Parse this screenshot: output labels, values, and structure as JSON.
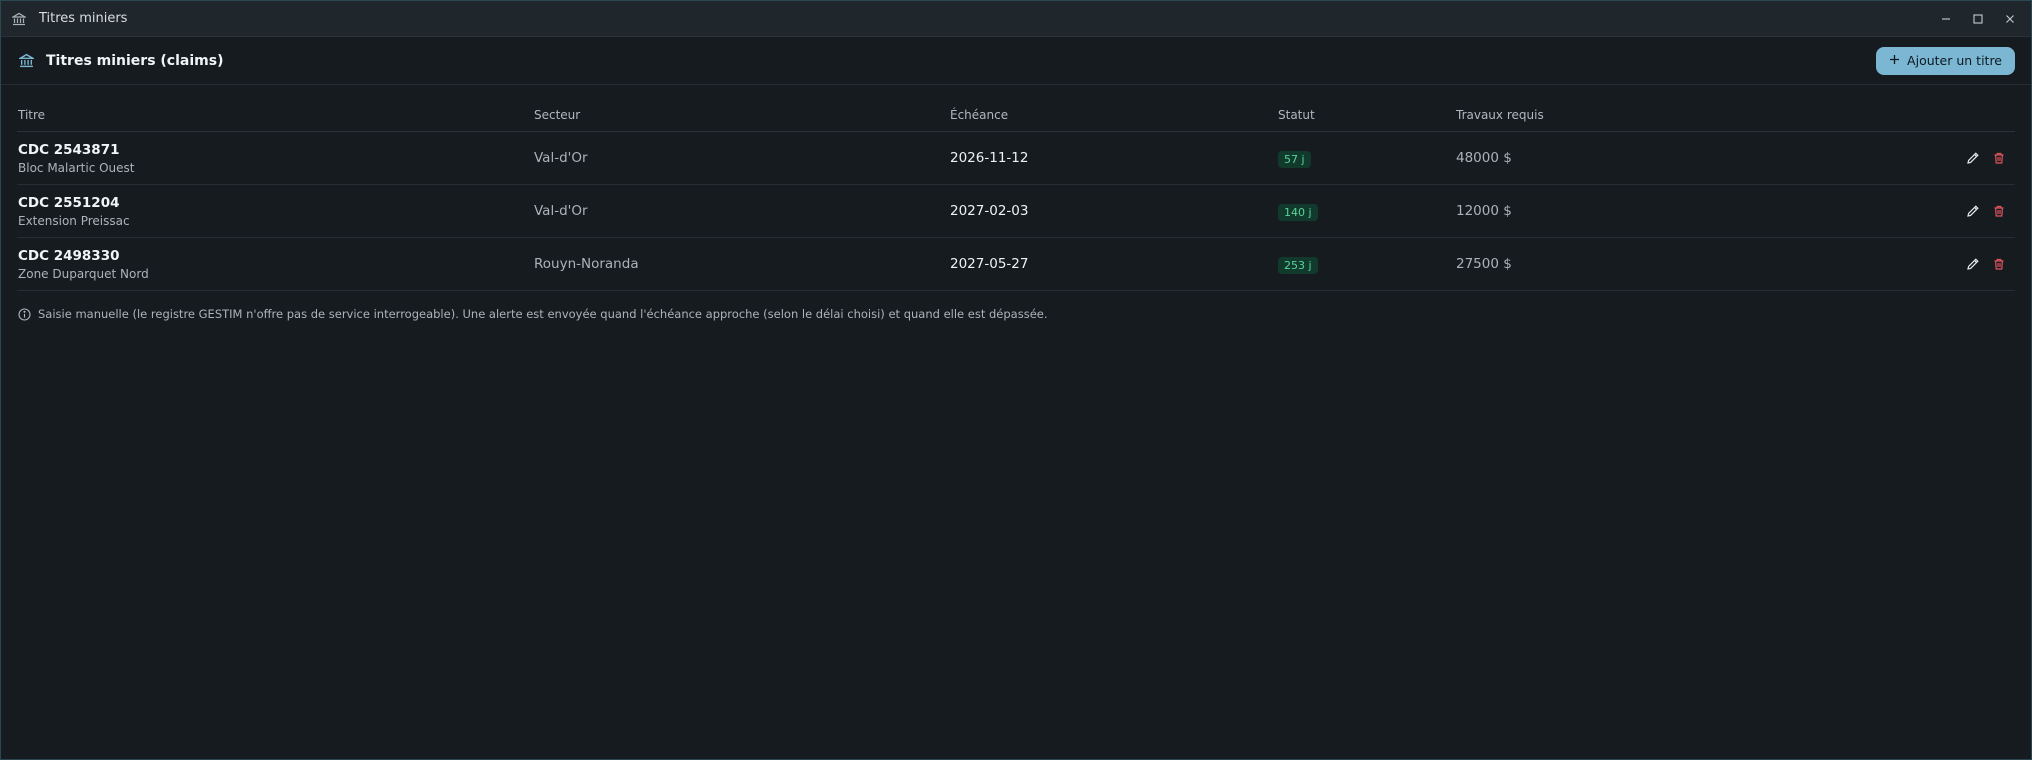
{
  "window": {
    "title": "Titres miniers"
  },
  "header": {
    "title": "Titres miniers (claims)",
    "add_label": "Ajouter un titre"
  },
  "table": {
    "columns": [
      "Titre",
      "Secteur",
      "Échéance",
      "Statut",
      "Travaux requis"
    ],
    "rows": [
      {
        "id": "CDC 2543871",
        "name": "Bloc Malartic Ouest",
        "sector": "Val-d'Or",
        "due": "2026-11-12",
        "status": "57 j",
        "work": "48000 $"
      },
      {
        "id": "CDC 2551204",
        "name": "Extension Preissac",
        "sector": "Val-d'Or",
        "due": "2027-02-03",
        "status": "140 j",
        "work": "12000 $"
      },
      {
        "id": "CDC 2498330",
        "name": "Zone Duparquet Nord",
        "sector": "Rouyn-Noranda",
        "due": "2027-05-27",
        "status": "253 j",
        "work": "27500 $"
      }
    ]
  },
  "note": "Saisie manuelle (le registre GESTIM n'offre pas de service interrogeable). Une alerte est envoyée quand l'échéance approche (selon le délai choisi) et quand elle est dépassée.",
  "colors": {
    "accent": "#7bb6d3",
    "badge_bg": "#113a2d",
    "badge_text": "#58d39b",
    "delete": "#e0545c"
  },
  "icons": {
    "app": "bank-icon",
    "add": "plus-icon",
    "edit": "pencil-icon",
    "delete": "trash-icon",
    "info": "info-icon"
  }
}
